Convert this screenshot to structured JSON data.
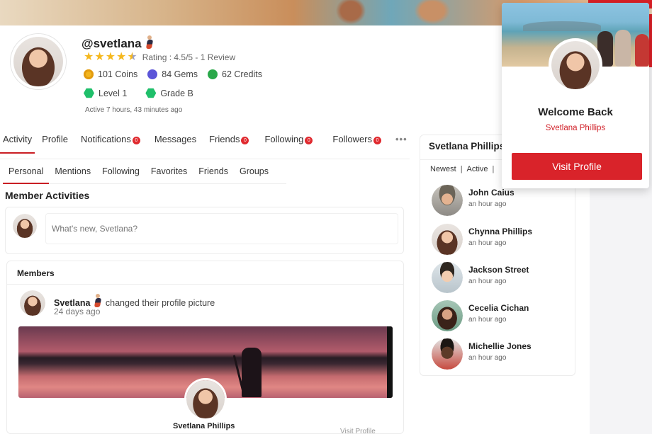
{
  "profile": {
    "username": "@svetlana",
    "rating_text": "Rating : 4.5/5 - 1 Review",
    "stats": [
      {
        "icon": "coin-icon",
        "label": "101 Coins"
      },
      {
        "icon": "gem-icon",
        "label": "84 Gems"
      },
      {
        "icon": "credit-icon",
        "label": "62 Credits"
      }
    ],
    "level": "Level 1",
    "grade": "Grade B",
    "active": "Active 7 hours, 43 minutes ago"
  },
  "tabs": [
    {
      "label": "Activity",
      "active": true
    },
    {
      "label": "Profile"
    },
    {
      "label": "Notifications",
      "badge": "0"
    },
    {
      "label": "Messages"
    },
    {
      "label": "Friends",
      "badge": "0"
    },
    {
      "label": "Following",
      "badge": "0"
    },
    {
      "label": "Followers",
      "badge": "0"
    }
  ],
  "subtabs": [
    "Personal",
    "Mentions",
    "Following",
    "Favorites",
    "Friends",
    "Groups"
  ],
  "section_title": "Member Activities",
  "composer": {
    "placeholder": "What's new, Svetlana?"
  },
  "members": {
    "title": "Members",
    "feed": {
      "name": "Svetlana",
      "action": "changed their profile picture",
      "time": "24 days ago",
      "card_name": "Svetlana Phillips",
      "card_visit": "Visit Profile"
    }
  },
  "sidebar": {
    "name": "Svetlana Phillips",
    "filters": [
      "Newest",
      "Active"
    ],
    "friends": [
      {
        "name": "John Caius",
        "time": "an hour ago"
      },
      {
        "name": "Chynna Phillips",
        "time": "an hour ago"
      },
      {
        "name": "Jackson Street",
        "time": "an hour ago"
      },
      {
        "name": "Cecelia Cichan",
        "time": "an hour ago"
      },
      {
        "name": "Michellie Jones",
        "time": "an hour ago"
      }
    ]
  },
  "popup": {
    "title": "Welcome Back",
    "name": "Svetlana Phillips",
    "button": "Visit Profile"
  },
  "colors": {
    "accent": "#d9232a",
    "star": "#f5b81e",
    "badge": "#e02a2f"
  }
}
